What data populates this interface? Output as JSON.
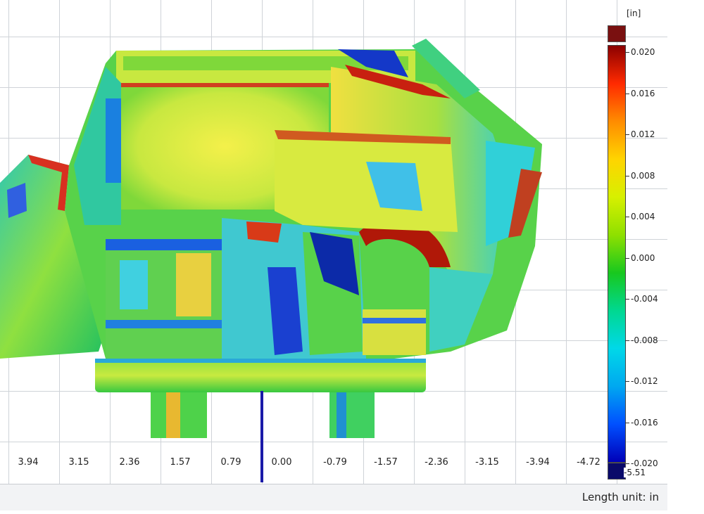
{
  "colors": {
    "grid": "#cfd3d8",
    "axis": "#1a1aa8",
    "colorbar_stops": [
      "#8b0000",
      "#ff2a00",
      "#ff8c00",
      "#ffd400",
      "#d7f000",
      "#8fe000",
      "#18c81e",
      "#00d890",
      "#00d8e8",
      "#00a8f0",
      "#0050ff",
      "#0000b8"
    ]
  },
  "x_axis": {
    "ticks": [
      "3.94",
      "3.15",
      "2.36",
      "1.57",
      "0.79",
      "0.00",
      "-0.79",
      "-1.57",
      "-2.36",
      "-3.15",
      "-3.94",
      "-4.72"
    ]
  },
  "legend": {
    "unit": "[in]",
    "labels": [
      "0.020",
      "0.016",
      "0.012",
      "0.008",
      "0.004",
      "0.000",
      "-0.004",
      "-0.008",
      "-0.012",
      "-0.016",
      "-0.020"
    ],
    "min_value": "-5.51"
  },
  "statusbar": {
    "length_unit": "Length unit: in"
  }
}
